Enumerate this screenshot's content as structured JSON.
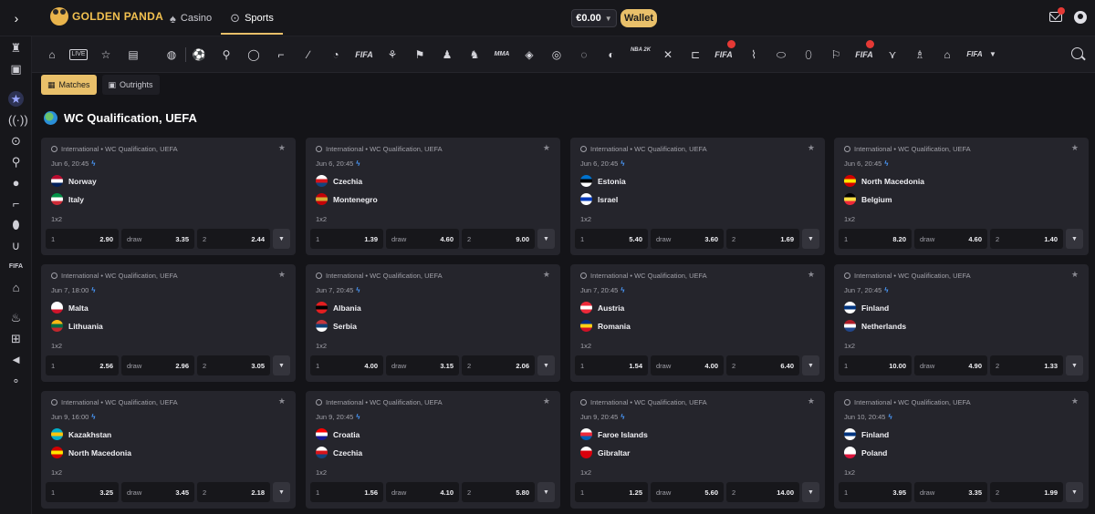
{
  "brand": {
    "name": "GOLDEN PANDA"
  },
  "topnav": [
    {
      "label": "Casino",
      "icon": "spade-icon"
    },
    {
      "label": "Sports",
      "icon": "soccer-ball-icon"
    }
  ],
  "account": {
    "balance": "€0.00",
    "wallet_label": "Wallet"
  },
  "tabs": [
    {
      "label": "Matches",
      "icon": "grid-icon"
    },
    {
      "label": "Outrights",
      "icon": "calendar-icon"
    }
  ],
  "sports_bar": {
    "text_icons": [
      "FIFA",
      "MMA",
      "NBA 2K",
      "FIFA",
      "FIFA",
      "FIFA"
    ]
  },
  "section": {
    "title": "WC Qualification, UEFA"
  },
  "sidebar": {
    "fifa_label": "FIFA"
  },
  "matches": [
    {
      "league": "International • WC Qualification, UEFA",
      "time": "Jun 6, 20:45",
      "home": "Norway",
      "away": "Italy",
      "market": "1x2",
      "odds": [
        {
          "label": "1",
          "value": "2.90"
        },
        {
          "label": "draw",
          "value": "3.35"
        },
        {
          "label": "2",
          "value": "2.44"
        }
      ],
      "home_flag": [
        "#ba0c2f",
        "#ffffff",
        "#00205b"
      ],
      "away_flag": [
        "#009246",
        "#ffffff",
        "#ce2b37"
      ]
    },
    {
      "league": "International • WC Qualification, UEFA",
      "time": "Jun 6, 20:45",
      "home": "Czechia",
      "away": "Montenegro",
      "market": "1x2",
      "odds": [
        {
          "label": "1",
          "value": "1.39"
        },
        {
          "label": "draw",
          "value": "4.60"
        },
        {
          "label": "2",
          "value": "9.00"
        }
      ],
      "home_flag": [
        "#ffffff",
        "#d7141a",
        "#11457e"
      ],
      "away_flag": [
        "#c40308",
        "#d4af37",
        "#c40308"
      ]
    },
    {
      "league": "International • WC Qualification, UEFA",
      "time": "Jun 6, 20:45",
      "home": "Estonia",
      "away": "Israel",
      "market": "1x2",
      "odds": [
        {
          "label": "1",
          "value": "5.40"
        },
        {
          "label": "draw",
          "value": "3.60"
        },
        {
          "label": "2",
          "value": "1.69"
        }
      ],
      "home_flag": [
        "#0072ce",
        "#000000",
        "#ffffff"
      ],
      "away_flag": [
        "#ffffff",
        "#0038b8",
        "#ffffff"
      ]
    },
    {
      "league": "International • WC Qualification, UEFA",
      "time": "Jun 6, 20:45",
      "home": "North Macedonia",
      "away": "Belgium",
      "market": "1x2",
      "odds": [
        {
          "label": "1",
          "value": "8.20"
        },
        {
          "label": "draw",
          "value": "4.60"
        },
        {
          "label": "2",
          "value": "1.40"
        }
      ],
      "home_flag": [
        "#d20000",
        "#ffe600",
        "#d20000"
      ],
      "away_flag": [
        "#000000",
        "#fae042",
        "#ed2939"
      ]
    },
    {
      "league": "International • WC Qualification, UEFA",
      "time": "Jun 7, 18:00",
      "home": "Malta",
      "away": "Lithuania",
      "market": "1x2",
      "odds": [
        {
          "label": "1",
          "value": "2.56"
        },
        {
          "label": "draw",
          "value": "2.96"
        },
        {
          "label": "2",
          "value": "3.05"
        }
      ],
      "home_flag": [
        "#ffffff",
        "#ffffff",
        "#cf142b"
      ],
      "away_flag": [
        "#fdb913",
        "#006a44",
        "#c1272d"
      ]
    },
    {
      "league": "International • WC Qualification, UEFA",
      "time": "Jun 7, 20:45",
      "home": "Albania",
      "away": "Serbia",
      "market": "1x2",
      "odds": [
        {
          "label": "1",
          "value": "4.00"
        },
        {
          "label": "draw",
          "value": "3.15"
        },
        {
          "label": "2",
          "value": "2.06"
        }
      ],
      "home_flag": [
        "#e41e20",
        "#000000",
        "#e41e20"
      ],
      "away_flag": [
        "#c6363c",
        "#0c4076",
        "#ffffff"
      ]
    },
    {
      "league": "International • WC Qualification, UEFA",
      "time": "Jun 7, 20:45",
      "home": "Austria",
      "away": "Romania",
      "market": "1x2",
      "odds": [
        {
          "label": "1",
          "value": "1.54"
        },
        {
          "label": "draw",
          "value": "4.00"
        },
        {
          "label": "2",
          "value": "6.40"
        }
      ],
      "home_flag": [
        "#ed2939",
        "#ffffff",
        "#ed2939"
      ],
      "away_flag": [
        "#002b7f",
        "#fcd116",
        "#ce1126"
      ]
    },
    {
      "league": "International • WC Qualification, UEFA",
      "time": "Jun 7, 20:45",
      "home": "Finland",
      "away": "Netherlands",
      "market": "1x2",
      "odds": [
        {
          "label": "1",
          "value": "10.00"
        },
        {
          "label": "draw",
          "value": "4.90"
        },
        {
          "label": "2",
          "value": "1.33"
        }
      ],
      "home_flag": [
        "#ffffff",
        "#003580",
        "#ffffff"
      ],
      "away_flag": [
        "#ae1c28",
        "#ffffff",
        "#21468b"
      ]
    },
    {
      "league": "International • WC Qualification, UEFA",
      "time": "Jun 9, 16:00",
      "home": "Kazakhstan",
      "away": "North Macedonia",
      "market": "1x2",
      "odds": [
        {
          "label": "1",
          "value": "3.25"
        },
        {
          "label": "draw",
          "value": "3.45"
        },
        {
          "label": "2",
          "value": "2.18"
        }
      ],
      "home_flag": [
        "#00afca",
        "#fec50c",
        "#00afca"
      ],
      "away_flag": [
        "#d20000",
        "#ffe600",
        "#d20000"
      ]
    },
    {
      "league": "International • WC Qualification, UEFA",
      "time": "Jun 9, 20:45",
      "home": "Croatia",
      "away": "Czechia",
      "market": "1x2",
      "odds": [
        {
          "label": "1",
          "value": "1.56"
        },
        {
          "label": "draw",
          "value": "4.10"
        },
        {
          "label": "2",
          "value": "5.80"
        }
      ],
      "home_flag": [
        "#ff0000",
        "#ffffff",
        "#171796"
      ],
      "away_flag": [
        "#ffffff",
        "#d7141a",
        "#11457e"
      ]
    },
    {
      "league": "International • WC Qualification, UEFA",
      "time": "Jun 9, 20:45",
      "home": "Faroe Islands",
      "away": "Gibraltar",
      "market": "1x2",
      "odds": [
        {
          "label": "1",
          "value": "1.25"
        },
        {
          "label": "draw",
          "value": "5.60"
        },
        {
          "label": "2",
          "value": "14.00"
        }
      ],
      "home_flag": [
        "#ffffff",
        "#ed2939",
        "#005eb8"
      ],
      "away_flag": [
        "#ffffff",
        "#da000c",
        "#da000c"
      ]
    },
    {
      "league": "International • WC Qualification, UEFA",
      "time": "Jun 10, 20:45",
      "home": "Finland",
      "away": "Poland",
      "market": "1x2",
      "odds": [
        {
          "label": "1",
          "value": "3.95"
        },
        {
          "label": "draw",
          "value": "3.35"
        },
        {
          "label": "2",
          "value": "1.99"
        }
      ],
      "home_flag": [
        "#ffffff",
        "#003580",
        "#ffffff"
      ],
      "away_flag": [
        "#ffffff",
        "#ffffff",
        "#dc143c"
      ]
    }
  ]
}
